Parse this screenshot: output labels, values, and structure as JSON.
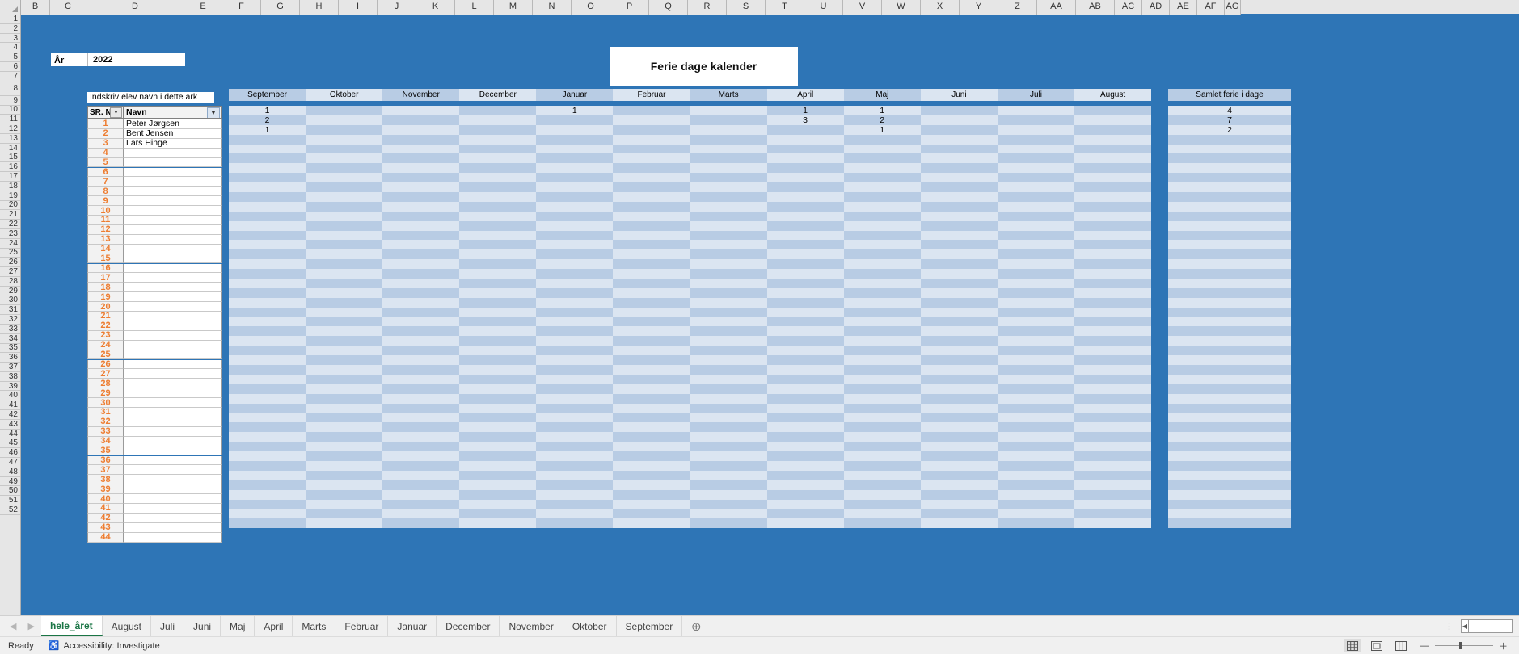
{
  "grid": {
    "column_letters": [
      "B",
      "C",
      "D",
      "E",
      "F",
      "G",
      "H",
      "I",
      "J",
      "K",
      "L",
      "M",
      "N",
      "O",
      "P",
      "Q",
      "R",
      "S",
      "T",
      "U",
      "V",
      "W",
      "X",
      "Y",
      "Z",
      "AA",
      "AB",
      "AC",
      "AD",
      "AE",
      "AF",
      "AG"
    ],
    "row_numbers": [
      1,
      2,
      3,
      4,
      5,
      6,
      7,
      8,
      9,
      10,
      11,
      12,
      13,
      14,
      15,
      16,
      17,
      18,
      19,
      20,
      21,
      22,
      23,
      24,
      25,
      26,
      27,
      28,
      29,
      30,
      31,
      32,
      33,
      34,
      35,
      36,
      37,
      38,
      39,
      40,
      41,
      42,
      43,
      44,
      45,
      46,
      47,
      48,
      49,
      50,
      51,
      52
    ]
  },
  "year_box": {
    "label": "År",
    "value": "2022"
  },
  "title": {
    "text": "Ferie dage kalender"
  },
  "name_table": {
    "note": "Indskriv elev navn i dette ark",
    "header_sr": "SR. N",
    "header_name": "Navn",
    "filter_icon": "filter-dropdown-icon",
    "rows": [
      {
        "sr": "1",
        "name": "Peter Jørgsen"
      },
      {
        "sr": "2",
        "name": "Bent Jensen"
      },
      {
        "sr": "3",
        "name": "Lars Hinge"
      },
      {
        "sr": "4",
        "name": ""
      },
      {
        "sr": "5",
        "name": ""
      },
      {
        "sr": "6",
        "name": ""
      },
      {
        "sr": "7",
        "name": ""
      },
      {
        "sr": "8",
        "name": ""
      },
      {
        "sr": "9",
        "name": ""
      },
      {
        "sr": "10",
        "name": ""
      },
      {
        "sr": "11",
        "name": ""
      },
      {
        "sr": "12",
        "name": ""
      },
      {
        "sr": "13",
        "name": ""
      },
      {
        "sr": "14",
        "name": ""
      },
      {
        "sr": "15",
        "name": ""
      },
      {
        "sr": "16",
        "name": ""
      },
      {
        "sr": "17",
        "name": ""
      },
      {
        "sr": "18",
        "name": ""
      },
      {
        "sr": "19",
        "name": ""
      },
      {
        "sr": "20",
        "name": ""
      },
      {
        "sr": "21",
        "name": ""
      },
      {
        "sr": "22",
        "name": ""
      },
      {
        "sr": "23",
        "name": ""
      },
      {
        "sr": "24",
        "name": ""
      },
      {
        "sr": "25",
        "name": ""
      },
      {
        "sr": "26",
        "name": ""
      },
      {
        "sr": "27",
        "name": ""
      },
      {
        "sr": "28",
        "name": ""
      },
      {
        "sr": "29",
        "name": ""
      },
      {
        "sr": "30",
        "name": ""
      },
      {
        "sr": "31",
        "name": ""
      },
      {
        "sr": "32",
        "name": ""
      },
      {
        "sr": "33",
        "name": ""
      },
      {
        "sr": "34",
        "name": ""
      },
      {
        "sr": "35",
        "name": ""
      },
      {
        "sr": "36",
        "name": ""
      },
      {
        "sr": "37",
        "name": ""
      },
      {
        "sr": "38",
        "name": ""
      },
      {
        "sr": "39",
        "name": ""
      },
      {
        "sr": "40",
        "name": ""
      },
      {
        "sr": "41",
        "name": ""
      },
      {
        "sr": "42",
        "name": ""
      },
      {
        "sr": "43",
        "name": ""
      },
      {
        "sr": "44",
        "name": ""
      }
    ]
  },
  "calendar": {
    "months": [
      "September",
      "Oktober",
      "November",
      "December",
      "Januar",
      "Februar",
      "Marts",
      "April",
      "Maj",
      "Juni",
      "Juli",
      "August"
    ],
    "total_header": "Samlet ferie i dage",
    "rows": [
      {
        "values": [
          "1",
          "",
          "",
          "",
          "1",
          "",
          "",
          "1",
          "1",
          "",
          "",
          ""
        ],
        "total": "4"
      },
      {
        "values": [
          "2",
          "",
          "",
          "",
          "",
          "",
          "",
          "3",
          "2",
          "",
          "",
          ""
        ],
        "total": "7"
      },
      {
        "values": [
          "1",
          "",
          "",
          "",
          "",
          "",
          "",
          "",
          "1",
          "",
          "",
          ""
        ],
        "total": "2"
      },
      {
        "values": [
          "",
          "",
          "",
          "",
          "",
          "",
          "",
          "",
          "",
          "",
          "",
          ""
        ],
        "total": ""
      },
      {
        "values": [
          "",
          "",
          "",
          "",
          "",
          "",
          "",
          "",
          "",
          "",
          "",
          ""
        ],
        "total": ""
      },
      {
        "values": [
          "",
          "",
          "",
          "",
          "",
          "",
          "",
          "",
          "",
          "",
          "",
          ""
        ],
        "total": ""
      },
      {
        "values": [
          "",
          "",
          "",
          "",
          "",
          "",
          "",
          "",
          "",
          "",
          "",
          ""
        ],
        "total": ""
      },
      {
        "values": [
          "",
          "",
          "",
          "",
          "",
          "",
          "",
          "",
          "",
          "",
          "",
          ""
        ],
        "total": ""
      },
      {
        "values": [
          "",
          "",
          "",
          "",
          "",
          "",
          "",
          "",
          "",
          "",
          "",
          ""
        ],
        "total": ""
      },
      {
        "values": [
          "",
          "",
          "",
          "",
          "",
          "",
          "",
          "",
          "",
          "",
          "",
          ""
        ],
        "total": ""
      },
      {
        "values": [
          "",
          "",
          "",
          "",
          "",
          "",
          "",
          "",
          "",
          "",
          "",
          ""
        ],
        "total": ""
      },
      {
        "values": [
          "",
          "",
          "",
          "",
          "",
          "",
          "",
          "",
          "",
          "",
          "",
          ""
        ],
        "total": ""
      },
      {
        "values": [
          "",
          "",
          "",
          "",
          "",
          "",
          "",
          "",
          "",
          "",
          "",
          ""
        ],
        "total": ""
      },
      {
        "values": [
          "",
          "",
          "",
          "",
          "",
          "",
          "",
          "",
          "",
          "",
          "",
          ""
        ],
        "total": ""
      },
      {
        "values": [
          "",
          "",
          "",
          "",
          "",
          "",
          "",
          "",
          "",
          "",
          "",
          ""
        ],
        "total": ""
      },
      {
        "values": [
          "",
          "",
          "",
          "",
          "",
          "",
          "",
          "",
          "",
          "",
          "",
          ""
        ],
        "total": ""
      },
      {
        "values": [
          "",
          "",
          "",
          "",
          "",
          "",
          "",
          "",
          "",
          "",
          "",
          ""
        ],
        "total": ""
      },
      {
        "values": [
          "",
          "",
          "",
          "",
          "",
          "",
          "",
          "",
          "",
          "",
          "",
          ""
        ],
        "total": ""
      },
      {
        "values": [
          "",
          "",
          "",
          "",
          "",
          "",
          "",
          "",
          "",
          "",
          "",
          ""
        ],
        "total": ""
      },
      {
        "values": [
          "",
          "",
          "",
          "",
          "",
          "",
          "",
          "",
          "",
          "",
          "",
          ""
        ],
        "total": ""
      },
      {
        "values": [
          "",
          "",
          "",
          "",
          "",
          "",
          "",
          "",
          "",
          "",
          "",
          ""
        ],
        "total": ""
      },
      {
        "values": [
          "",
          "",
          "",
          "",
          "",
          "",
          "",
          "",
          "",
          "",
          "",
          ""
        ],
        "total": ""
      },
      {
        "values": [
          "",
          "",
          "",
          "",
          "",
          "",
          "",
          "",
          "",
          "",
          "",
          ""
        ],
        "total": ""
      },
      {
        "values": [
          "",
          "",
          "",
          "",
          "",
          "",
          "",
          "",
          "",
          "",
          "",
          ""
        ],
        "total": ""
      },
      {
        "values": [
          "",
          "",
          "",
          "",
          "",
          "",
          "",
          "",
          "",
          "",
          "",
          ""
        ],
        "total": ""
      },
      {
        "values": [
          "",
          "",
          "",
          "",
          "",
          "",
          "",
          "",
          "",
          "",
          "",
          ""
        ],
        "total": ""
      },
      {
        "values": [
          "",
          "",
          "",
          "",
          "",
          "",
          "",
          "",
          "",
          "",
          "",
          ""
        ],
        "total": ""
      },
      {
        "values": [
          "",
          "",
          "",
          "",
          "",
          "",
          "",
          "",
          "",
          "",
          "",
          ""
        ],
        "total": ""
      },
      {
        "values": [
          "",
          "",
          "",
          "",
          "",
          "",
          "",
          "",
          "",
          "",
          "",
          ""
        ],
        "total": ""
      },
      {
        "values": [
          "",
          "",
          "",
          "",
          "",
          "",
          "",
          "",
          "",
          "",
          "",
          ""
        ],
        "total": ""
      },
      {
        "values": [
          "",
          "",
          "",
          "",
          "",
          "",
          "",
          "",
          "",
          "",
          "",
          ""
        ],
        "total": ""
      },
      {
        "values": [
          "",
          "",
          "",
          "",
          "",
          "",
          "",
          "",
          "",
          "",
          "",
          ""
        ],
        "total": ""
      },
      {
        "values": [
          "",
          "",
          "",
          "",
          "",
          "",
          "",
          "",
          "",
          "",
          "",
          ""
        ],
        "total": ""
      },
      {
        "values": [
          "",
          "",
          "",
          "",
          "",
          "",
          "",
          "",
          "",
          "",
          "",
          ""
        ],
        "total": ""
      },
      {
        "values": [
          "",
          "",
          "",
          "",
          "",
          "",
          "",
          "",
          "",
          "",
          "",
          ""
        ],
        "total": ""
      },
      {
        "values": [
          "",
          "",
          "",
          "",
          "",
          "",
          "",
          "",
          "",
          "",
          "",
          ""
        ],
        "total": ""
      },
      {
        "values": [
          "",
          "",
          "",
          "",
          "",
          "",
          "",
          "",
          "",
          "",
          "",
          ""
        ],
        "total": ""
      },
      {
        "values": [
          "",
          "",
          "",
          "",
          "",
          "",
          "",
          "",
          "",
          "",
          "",
          ""
        ],
        "total": ""
      },
      {
        "values": [
          "",
          "",
          "",
          "",
          "",
          "",
          "",
          "",
          "",
          "",
          "",
          ""
        ],
        "total": ""
      },
      {
        "values": [
          "",
          "",
          "",
          "",
          "",
          "",
          "",
          "",
          "",
          "",
          "",
          ""
        ],
        "total": ""
      },
      {
        "values": [
          "",
          "",
          "",
          "",
          "",
          "",
          "",
          "",
          "",
          "",
          "",
          ""
        ],
        "total": ""
      },
      {
        "values": [
          "",
          "",
          "",
          "",
          "",
          "",
          "",
          "",
          "",
          "",
          "",
          ""
        ],
        "total": ""
      },
      {
        "values": [
          "",
          "",
          "",
          "",
          "",
          "",
          "",
          "",
          "",
          "",
          "",
          ""
        ],
        "total": ""
      },
      {
        "values": [
          "",
          "",
          "",
          "",
          "",
          "",
          "",
          "",
          "",
          "",
          "",
          ""
        ],
        "total": ""
      }
    ]
  },
  "sheet_tabs": {
    "prev_icon": "chevron-left-icon",
    "next_icon": "chevron-right-icon",
    "add_icon": "add-sheet-icon",
    "tabs": [
      {
        "label": "hele_året",
        "active": true
      },
      {
        "label": "August",
        "active": false
      },
      {
        "label": "Juli",
        "active": false
      },
      {
        "label": "Juni",
        "active": false
      },
      {
        "label": "Maj",
        "active": false
      },
      {
        "label": "April",
        "active": false
      },
      {
        "label": "Marts",
        "active": false
      },
      {
        "label": "Februar",
        "active": false
      },
      {
        "label": "Januar",
        "active": false
      },
      {
        "label": "December",
        "active": false
      },
      {
        "label": "November",
        "active": false
      },
      {
        "label": "Oktober",
        "active": false
      },
      {
        "label": "September",
        "active": false
      }
    ]
  },
  "status_bar": {
    "ready": "Ready",
    "accessibility": "Accessibility: Investigate",
    "accessibility_icon": "accessibility-icon",
    "view_normal_icon": "normal-view-icon",
    "view_pagelayout_icon": "page-layout-view-icon",
    "view_pagebreak_icon": "page-break-view-icon",
    "zoom_out_icon": "zoom-out-icon",
    "zoom_in_icon": "zoom-in-icon"
  },
  "colors": {
    "sheet_background": "#2e75b6",
    "band_light": "#dbe5f1",
    "band_dark": "#b8cce4",
    "sr_orange": "#ED7D31",
    "active_tab_green": "#1a7545"
  }
}
